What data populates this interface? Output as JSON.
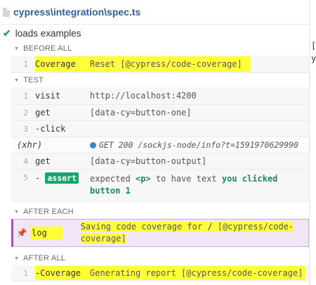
{
  "header": {
    "spec_path": "cypress\\integration\\spec.ts"
  },
  "test": {
    "title": "loads examples"
  },
  "sections": {
    "before_all": "BEFORE ALL",
    "test": "TEST",
    "after_each": "AFTER EACH",
    "after_all": "AFTER ALL"
  },
  "before_all_cmd": {
    "num": "1",
    "name": "Coverage",
    "msg": "Reset [@cypress/code-coverage]"
  },
  "test_cmds": {
    "c1": {
      "num": "1",
      "name": "visit",
      "msg": "http://localhost:4200"
    },
    "c2": {
      "num": "2",
      "name": "get",
      "msg": "[data-cy=button-one]"
    },
    "c3": {
      "num": "3",
      "name": "-click"
    },
    "xhr": {
      "label": "(xhr)",
      "msg": "GET 200 /sockjs-node/info?t=1591970629990"
    },
    "c4": {
      "num": "4",
      "name": "get",
      "msg": "[data-cy=button-output]"
    },
    "c5": {
      "num": "5",
      "dash": "-",
      "badge": "assert",
      "expected": "expected",
      "el": "<p>",
      "mid": "to have text",
      "val1": "you clicked",
      "val2": "button 1"
    }
  },
  "after_each_cmd": {
    "name": "log",
    "msg1": "Saving code coverage for",
    "slash": "/",
    "msg2": "[@cypress/code-",
    "msg3": "coverage]"
  },
  "after_all_cmd": {
    "num": "1",
    "name": "-Coverage",
    "msg": "Generating report [@cypress/code-coverage]"
  },
  "right_fragment": {
    "line1": "[",
    "line2": "y"
  },
  "colors": {
    "accent": "#2e5e9e",
    "pass": "#1fa971",
    "highlight": "#ffff3a",
    "pinned": "#9b59b6"
  }
}
